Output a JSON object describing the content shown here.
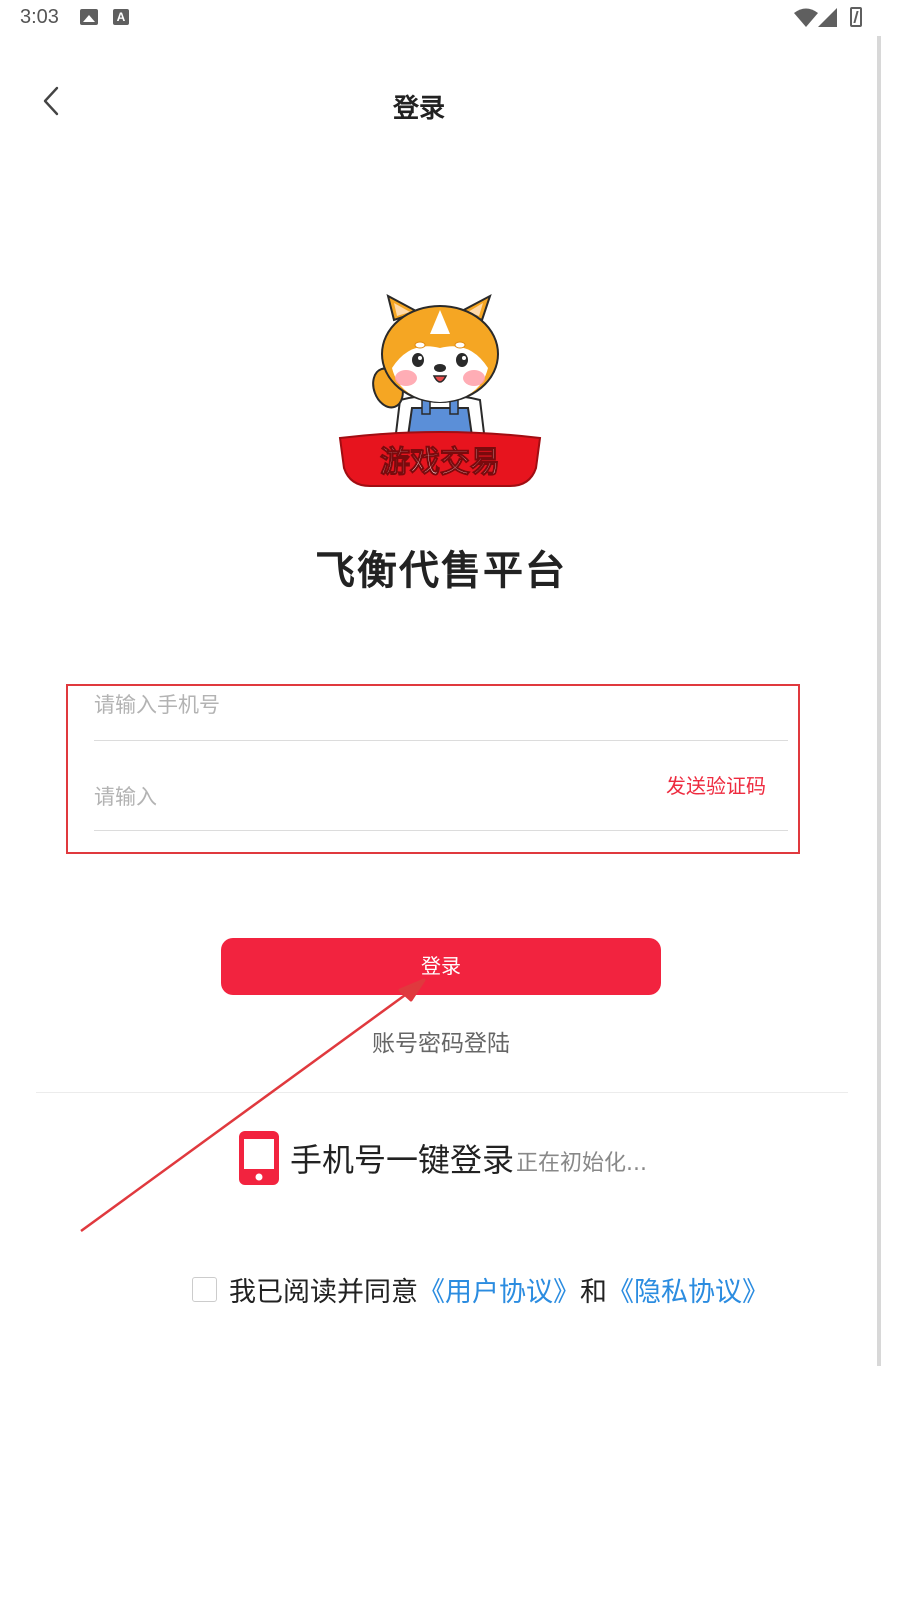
{
  "status_bar": {
    "time": "3:03",
    "a_icon_letter": "A"
  },
  "header": {
    "title": "登录"
  },
  "logo": {
    "banner_text": "游戏交易"
  },
  "app_name": "飞衡代售平台",
  "form": {
    "phone_placeholder": "请输入手机号",
    "code_placeholder": "请输入",
    "send_code_label": "发送验证码"
  },
  "login_button_label": "登录",
  "account_login_label": "账号密码登陆",
  "one_key": {
    "label": "手机号一键登录",
    "status": "正在初始化..."
  },
  "agreement": {
    "prefix": "我已阅读并同意",
    "user_link": "《用户协议》",
    "and": "和",
    "privacy_link": "《隐私协议》"
  },
  "colors": {
    "accent": "#f2233f",
    "link": "#2b8ce0",
    "annotation": "#e0393e"
  },
  "icons": [
    "image-icon",
    "a-letter-icon",
    "wifi-icon",
    "signal-icon",
    "battery-icon",
    "back-arrow-icon",
    "phone-icon"
  ]
}
